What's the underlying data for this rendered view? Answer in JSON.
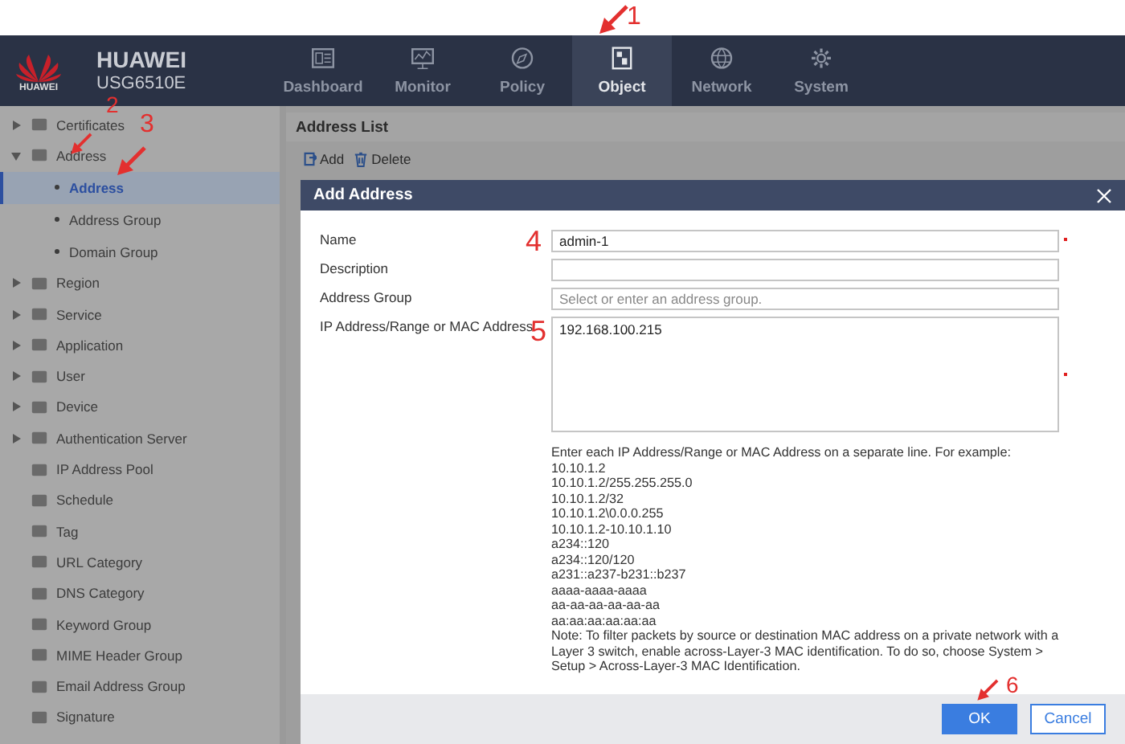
{
  "header": {
    "logo_text": "HUAWEI",
    "product": "HUAWEI",
    "model": "USG6510E",
    "nav": [
      {
        "label": "Dashboard",
        "selected": false
      },
      {
        "label": "Monitor",
        "selected": false
      },
      {
        "label": "Policy",
        "selected": false
      },
      {
        "label": "Object",
        "selected": true
      },
      {
        "label": "Network",
        "selected": false
      },
      {
        "label": "System",
        "selected": false
      }
    ]
  },
  "sidebar": {
    "items": [
      {
        "label": "Certificates",
        "kind": "group",
        "expanded": false,
        "selected": false
      },
      {
        "label": "Address",
        "kind": "group",
        "expanded": true,
        "selected": false,
        "children": [
          {
            "label": "Address",
            "kind": "sub",
            "selected": true
          },
          {
            "label": "Address Group",
            "kind": "sub",
            "selected": false
          },
          {
            "label": "Domain Group",
            "kind": "sub",
            "selected": false
          }
        ]
      },
      {
        "label": "Region",
        "kind": "group",
        "expanded": false,
        "selected": false
      },
      {
        "label": "Service",
        "kind": "group",
        "expanded": false,
        "selected": false
      },
      {
        "label": "Application",
        "kind": "group",
        "expanded": false,
        "selected": false
      },
      {
        "label": "User",
        "kind": "group",
        "expanded": false,
        "selected": false
      },
      {
        "label": "Device",
        "kind": "group",
        "expanded": false,
        "selected": false
      },
      {
        "label": "Authentication Server",
        "kind": "group",
        "expanded": false,
        "selected": false
      },
      {
        "label": "IP Address Pool",
        "kind": "leaf",
        "selected": false
      },
      {
        "label": "Schedule",
        "kind": "leaf",
        "selected": false
      },
      {
        "label": "Tag",
        "kind": "leaf",
        "selected": false
      },
      {
        "label": "URL Category",
        "kind": "leaf",
        "selected": false
      },
      {
        "label": "DNS Category",
        "kind": "leaf",
        "selected": false
      },
      {
        "label": "Keyword Group",
        "kind": "leaf",
        "selected": false
      },
      {
        "label": "MIME Header Group",
        "kind": "leaf",
        "selected": false
      },
      {
        "label": "Email Address Group",
        "kind": "leaf",
        "selected": false
      },
      {
        "label": "Signature",
        "kind": "leaf",
        "selected": false
      }
    ]
  },
  "main": {
    "title": "Address List",
    "toolbar": [
      {
        "label": "Add"
      },
      {
        "label": "Delete"
      }
    ]
  },
  "dialog": {
    "title": "Add Address",
    "fields": [
      {
        "label": "Name",
        "kind": "input",
        "value": "admin-1",
        "required": true
      },
      {
        "label": "Description",
        "kind": "input",
        "required": false
      },
      {
        "label": "Address Group",
        "kind": "input",
        "placeholder": "Select or enter an address group.",
        "required": false
      },
      {
        "label": "IP Address/Range or MAC Address",
        "kind": "textarea",
        "value": "192.168.100.215",
        "required": true
      }
    ],
    "help_lines": [
      "Enter each IP Address/Range or MAC Address on a separate line. For example:",
      "10.10.1.2",
      "10.10.1.2/255.255.255.0",
      "10.10.1.2/32",
      "10.10.1.2\\0.0.0.255",
      "10.10.1.2-10.10.1.10",
      "a234::120",
      "a234::120/120",
      "a231::a237-b231::b237",
      "aaaa-aaaa-aaaa",
      "aa-aa-aa-aa-aa-aa",
      "aa:aa:aa:aa:aa:aa"
    ],
    "note": "Note: To filter packets by source or destination MAC address on a private network with a Layer 3 switch, enable across-Layer-3 MAC identification. To do so, choose System > Setup > Across-Layer-3 MAC Identification.",
    "buttons": [
      {
        "label": "OK",
        "kind": "primary"
      },
      {
        "label": "Cancel",
        "kind": "secondary"
      }
    ]
  },
  "annotations": [
    {
      "label": "1",
      "kind": "arrow"
    },
    {
      "label": "2",
      "kind": "arrow"
    },
    {
      "label": "3",
      "kind": "arrow"
    },
    {
      "label": "4",
      "kind": "number"
    },
    {
      "label": "5",
      "kind": "number"
    },
    {
      "label": "6",
      "kind": "arrow"
    }
  ]
}
